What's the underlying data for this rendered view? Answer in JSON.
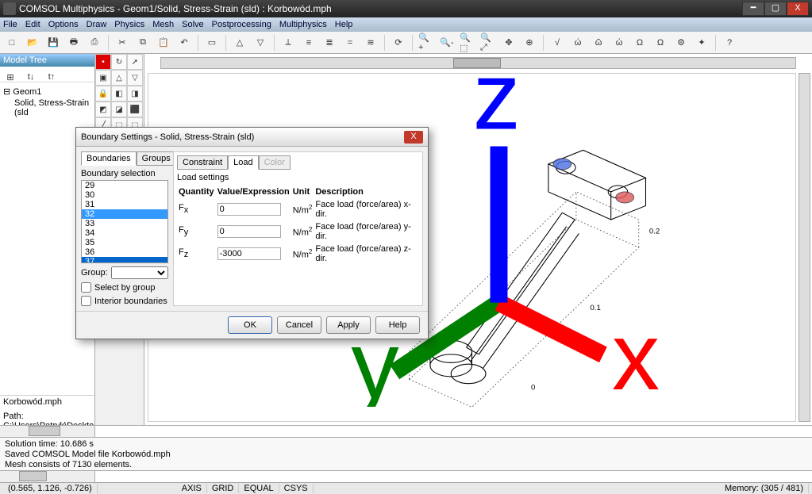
{
  "window": {
    "title": "COMSOL Multiphysics - Geom1/Solid, Stress-Strain (sld) : Korbowód.mph",
    "minimize": "━",
    "maximize": "▢",
    "close": "X"
  },
  "menu": {
    "file": "File",
    "edit": "Edit",
    "options": "Options",
    "draw": "Draw",
    "physics": "Physics",
    "mesh": "Mesh",
    "solve": "Solve",
    "postprocessing": "Postprocessing",
    "multiphysics": "Multiphysics",
    "help": "Help"
  },
  "toolbar": {
    "new": "□",
    "open": "📂",
    "save": "💾",
    "print": "🖶",
    "printprev": "⎙",
    "cut": "✂",
    "copy": "⧉",
    "paste": "📋",
    "undo": "↶",
    "pointer": "▭",
    "triangle": "△",
    "triangle2": "▽",
    "axis": "⟂",
    "meshline": "≡",
    "meshfill": "≣",
    "solve": "=",
    "solveplus": "≋",
    "refresh": "⟳",
    "zoomin": "🔍+",
    "zoomout": "🔍-",
    "zoomwin": "🔍⬚",
    "zoomext": "🔍⤢",
    "pan": "✥",
    "target": "⊕",
    "info": "√",
    "omega1": "ώ",
    "omega2": "ῶ",
    "omega3": "ώ",
    "bigomega": "Ω",
    "big2": "Ω",
    "gear": "⚙",
    "wiz": "✦",
    "help": "?"
  },
  "modeltree": {
    "title": "Model Tree",
    "root": "Geom1",
    "child": "Solid, Stress-Strain (sld"
  },
  "info": {
    "filename": "Korbowód.mph",
    "path": "Path: C:\\Users\\Patryk\\Deskto"
  },
  "dialog": {
    "title": "Boundary Settings - Solid, Stress-Strain (sld)",
    "tab_boundaries": "Boundaries",
    "tab_groups": "Groups",
    "selection_label": "Boundary selection",
    "list": [
      "29",
      "30",
      "31",
      "32",
      "33",
      "34",
      "35",
      "36",
      "37"
    ],
    "selected": "32",
    "last": "37",
    "group_label": "Group:",
    "chk_selectgroup": "Select by group",
    "chk_interior": "Interior boundaries",
    "tab_constraint": "Constraint",
    "tab_load": "Load",
    "tab_color": "Color",
    "load_settings_label": "Load settings",
    "headers": {
      "q": "Quantity",
      "v": "Value/Expression",
      "u": "Unit",
      "d": "Description"
    },
    "rows": [
      {
        "q": "F_x",
        "v": "0",
        "u": "N/m²",
        "d": "Face load (force/area) x-dir."
      },
      {
        "q": "F_y",
        "v": "0",
        "u": "N/m²",
        "d": "Face load (force/area) y-dir."
      },
      {
        "q": "F_z",
        "v": "-3000",
        "u": "N/m²",
        "d": "Face load (force/area) z-dir."
      }
    ],
    "btn_ok": "OK",
    "btn_cancel": "Cancel",
    "btn_apply": "Apply",
    "btn_help": "Help"
  },
  "canvas": {
    "tick1": "0.2",
    "tick2": "0.1",
    "tick3": "0",
    "axis_x": "x",
    "axis_y": "y",
    "axis_z": "z"
  },
  "console": {
    "line1": "Solution time: 10.686 s",
    "line2": "Saved COMSOL Model file Korbowód.mph",
    "line3": "Mesh consists of 7130 elements."
  },
  "status": {
    "coords": "(0.565, 1.126, -0.726)",
    "axis": "AXIS",
    "grid": "GRID",
    "equal": "EQUAL",
    "csys": "CSYS",
    "memory": "Memory: (305 / 481)"
  }
}
